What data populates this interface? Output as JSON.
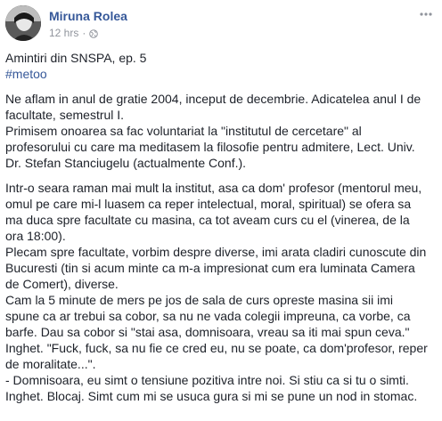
{
  "post": {
    "author": "Miruna Rolea",
    "time": "12 hrs",
    "separator": "·",
    "privacy_icon": "globe-icon",
    "more_icon": "more-options-icon",
    "title": "Amintiri din SNSPA, ep. 5",
    "hashtag": "#metoo",
    "paragraphs": [
      [
        "Ne aflam in anul de gratie 2004, inceput de decembrie. Adicatelea anul I de",
        "facultate, semestrul I.",
        "Primisem onoarea sa fac voluntariat la \"institutul de cercetare\" al",
        "profesorului cu care ma meditasem la filosofie pentru admitere, Lect. Univ.",
        "Dr. Stefan Stanciugelu (actualmente Conf.)."
      ],
      [
        "Intr-o seara raman mai mult la institut, asa ca dom' profesor (mentorul meu,",
        "omul pe care mi-l luasem ca reper intelectual, moral, spiritual) se ofera sa",
        "ma duca spre facultate cu masina, ca tot aveam curs cu el (vinerea, de la",
        "ora 18:00).",
        "Plecam spre facultate, vorbim despre diverse, imi arata cladiri cunoscute din",
        "Bucuresti (tin si acum minte ca m-a impresionat cum era luminata Camera",
        "de Comert), diverse.",
        "Cam la 5 minute de mers pe jos de sala de curs opreste masina sii imi",
        "spune ca ar trebui sa cobor, sa nu ne vada colegii impreuna, ca vorbe, ca",
        "barfe. Dau sa cobor si \"stai asa, domnisoara, vreau sa iti mai spun ceva.\"",
        "Inghet. \"Fuck, fuck, sa nu fie ce cred eu, nu se poate, ca dom'profesor, reper",
        "de moralitate...\".",
        "- Domnisoara, eu simt o tensiune pozitiva intre noi. Si stiu ca si tu o simti.",
        "Inghet. Blocaj. Simt cum mi se usuca gura si mi se pune un nod in stomac."
      ]
    ]
  }
}
